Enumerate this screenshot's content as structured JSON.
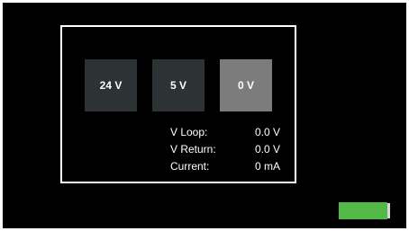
{
  "colors": {
    "background": "#000000",
    "panel_border": "#ffffff",
    "button_inactive": "#2d3234",
    "button_selected": "#7c7c7c",
    "text": "#ffffff",
    "battery_fill": "#52b848"
  },
  "voltage_buttons": [
    {
      "label": "24 V",
      "selected": false
    },
    {
      "label": "5 V",
      "selected": false
    },
    {
      "label": "0 V",
      "selected": true
    }
  ],
  "readings": {
    "v_loop": {
      "label": "V Loop:",
      "value": "0.0 V"
    },
    "v_return": {
      "label": "V Return:",
      "value": "0.0 V"
    },
    "current": {
      "label": "Current:",
      "value": "0 mA"
    }
  },
  "battery": {
    "level": 1.0,
    "icon": "battery-icon"
  }
}
